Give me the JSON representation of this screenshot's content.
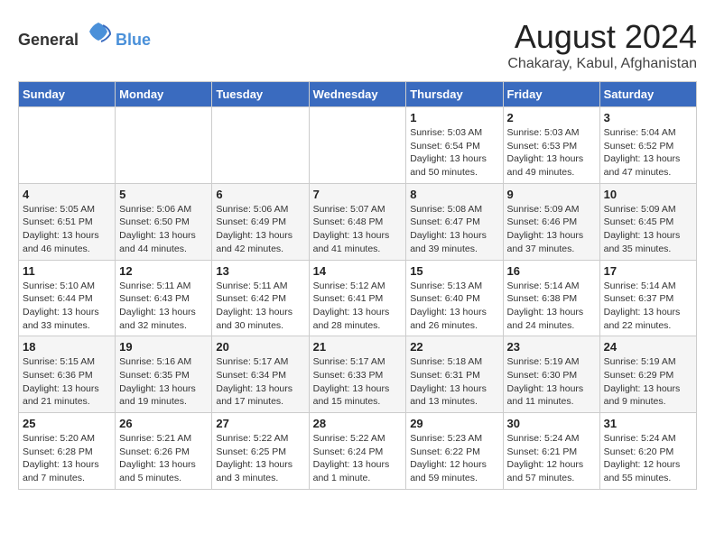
{
  "logo": {
    "general": "General",
    "blue": "Blue"
  },
  "title": "August 2024",
  "subtitle": "Chakaray, Kabul, Afghanistan",
  "weekdays": [
    "Sunday",
    "Monday",
    "Tuesday",
    "Wednesday",
    "Thursday",
    "Friday",
    "Saturday"
  ],
  "weeks": [
    [
      {
        "day": "",
        "info": ""
      },
      {
        "day": "",
        "info": ""
      },
      {
        "day": "",
        "info": ""
      },
      {
        "day": "",
        "info": ""
      },
      {
        "day": "1",
        "info": "Sunrise: 5:03 AM\nSunset: 6:54 PM\nDaylight: 13 hours and 50 minutes."
      },
      {
        "day": "2",
        "info": "Sunrise: 5:03 AM\nSunset: 6:53 PM\nDaylight: 13 hours and 49 minutes."
      },
      {
        "day": "3",
        "info": "Sunrise: 5:04 AM\nSunset: 6:52 PM\nDaylight: 13 hours and 47 minutes."
      }
    ],
    [
      {
        "day": "4",
        "info": "Sunrise: 5:05 AM\nSunset: 6:51 PM\nDaylight: 13 hours and 46 minutes."
      },
      {
        "day": "5",
        "info": "Sunrise: 5:06 AM\nSunset: 6:50 PM\nDaylight: 13 hours and 44 minutes."
      },
      {
        "day": "6",
        "info": "Sunrise: 5:06 AM\nSunset: 6:49 PM\nDaylight: 13 hours and 42 minutes."
      },
      {
        "day": "7",
        "info": "Sunrise: 5:07 AM\nSunset: 6:48 PM\nDaylight: 13 hours and 41 minutes."
      },
      {
        "day": "8",
        "info": "Sunrise: 5:08 AM\nSunset: 6:47 PM\nDaylight: 13 hours and 39 minutes."
      },
      {
        "day": "9",
        "info": "Sunrise: 5:09 AM\nSunset: 6:46 PM\nDaylight: 13 hours and 37 minutes."
      },
      {
        "day": "10",
        "info": "Sunrise: 5:09 AM\nSunset: 6:45 PM\nDaylight: 13 hours and 35 minutes."
      }
    ],
    [
      {
        "day": "11",
        "info": "Sunrise: 5:10 AM\nSunset: 6:44 PM\nDaylight: 13 hours and 33 minutes."
      },
      {
        "day": "12",
        "info": "Sunrise: 5:11 AM\nSunset: 6:43 PM\nDaylight: 13 hours and 32 minutes."
      },
      {
        "day": "13",
        "info": "Sunrise: 5:11 AM\nSunset: 6:42 PM\nDaylight: 13 hours and 30 minutes."
      },
      {
        "day": "14",
        "info": "Sunrise: 5:12 AM\nSunset: 6:41 PM\nDaylight: 13 hours and 28 minutes."
      },
      {
        "day": "15",
        "info": "Sunrise: 5:13 AM\nSunset: 6:40 PM\nDaylight: 13 hours and 26 minutes."
      },
      {
        "day": "16",
        "info": "Sunrise: 5:14 AM\nSunset: 6:38 PM\nDaylight: 13 hours and 24 minutes."
      },
      {
        "day": "17",
        "info": "Sunrise: 5:14 AM\nSunset: 6:37 PM\nDaylight: 13 hours and 22 minutes."
      }
    ],
    [
      {
        "day": "18",
        "info": "Sunrise: 5:15 AM\nSunset: 6:36 PM\nDaylight: 13 hours and 21 minutes."
      },
      {
        "day": "19",
        "info": "Sunrise: 5:16 AM\nSunset: 6:35 PM\nDaylight: 13 hours and 19 minutes."
      },
      {
        "day": "20",
        "info": "Sunrise: 5:17 AM\nSunset: 6:34 PM\nDaylight: 13 hours and 17 minutes."
      },
      {
        "day": "21",
        "info": "Sunrise: 5:17 AM\nSunset: 6:33 PM\nDaylight: 13 hours and 15 minutes."
      },
      {
        "day": "22",
        "info": "Sunrise: 5:18 AM\nSunset: 6:31 PM\nDaylight: 13 hours and 13 minutes."
      },
      {
        "day": "23",
        "info": "Sunrise: 5:19 AM\nSunset: 6:30 PM\nDaylight: 13 hours and 11 minutes."
      },
      {
        "day": "24",
        "info": "Sunrise: 5:19 AM\nSunset: 6:29 PM\nDaylight: 13 hours and 9 minutes."
      }
    ],
    [
      {
        "day": "25",
        "info": "Sunrise: 5:20 AM\nSunset: 6:28 PM\nDaylight: 13 hours and 7 minutes."
      },
      {
        "day": "26",
        "info": "Sunrise: 5:21 AM\nSunset: 6:26 PM\nDaylight: 13 hours and 5 minutes."
      },
      {
        "day": "27",
        "info": "Sunrise: 5:22 AM\nSunset: 6:25 PM\nDaylight: 13 hours and 3 minutes."
      },
      {
        "day": "28",
        "info": "Sunrise: 5:22 AM\nSunset: 6:24 PM\nDaylight: 13 hours and 1 minute."
      },
      {
        "day": "29",
        "info": "Sunrise: 5:23 AM\nSunset: 6:22 PM\nDaylight: 12 hours and 59 minutes."
      },
      {
        "day": "30",
        "info": "Sunrise: 5:24 AM\nSunset: 6:21 PM\nDaylight: 12 hours and 57 minutes."
      },
      {
        "day": "31",
        "info": "Sunrise: 5:24 AM\nSunset: 6:20 PM\nDaylight: 12 hours and 55 minutes."
      }
    ]
  ]
}
